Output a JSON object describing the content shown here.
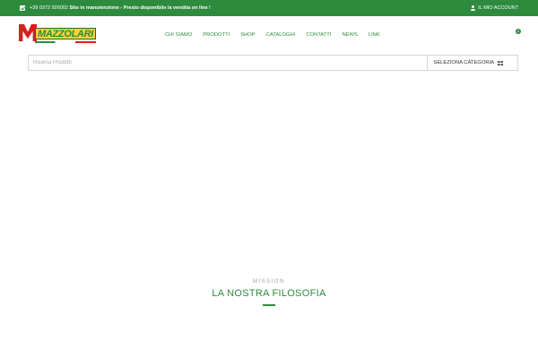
{
  "topbar": {
    "phone": "+39 0372 926002",
    "notice": "Sito in manutenzione - Presto disponibile la vendita on line !",
    "account_label": "IL MIO ACCOUNT",
    "background_color": "#2e8b3e"
  },
  "logo": {
    "text": "MAZZOLARI"
  },
  "nav": {
    "items": [
      "CHI SIAMO",
      "PRODOTTI",
      "SHOP",
      "CATALOGHI",
      "CONTATTI",
      "NEWS",
      "LINK"
    ]
  },
  "cart": {
    "count": "0"
  },
  "search": {
    "placeholder": "Ricerca Prodotti",
    "value": "",
    "category_label": "SELEZIONA CATEGORIA"
  },
  "section": {
    "eyebrow": "MISSION",
    "title": "LA NOSTRA FILOSOFIA"
  },
  "colors": {
    "accent": "#2e8b3e",
    "logo_red": "#d81e1e",
    "logo_yellow": "#f6d33a"
  }
}
